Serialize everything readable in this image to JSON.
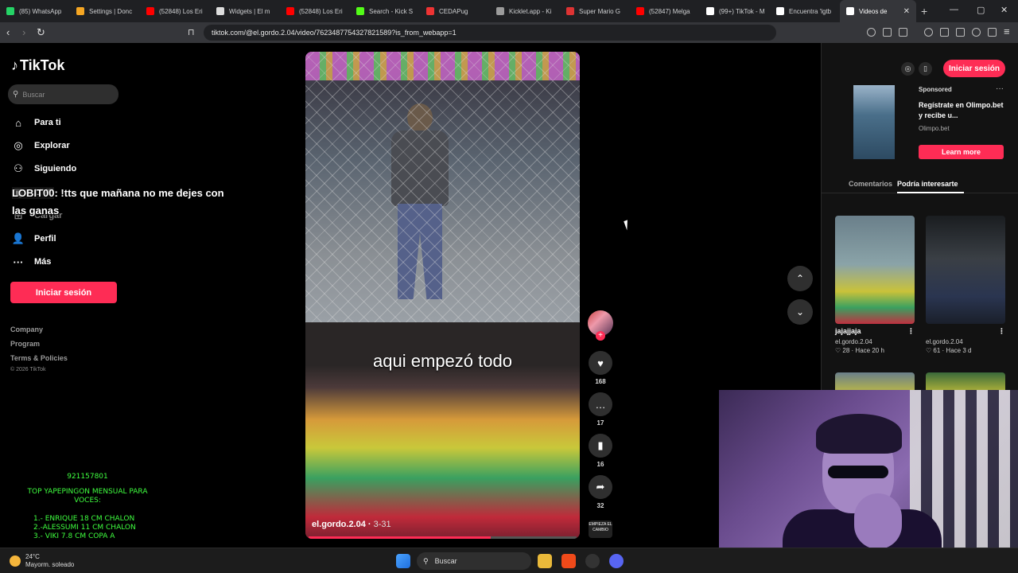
{
  "browser": {
    "tabs": [
      {
        "label": "(85) WhatsApp",
        "color": "#25d366"
      },
      {
        "label": "Settings | Donc",
        "color": "#f5a623"
      },
      {
        "label": "(52848) Los Eri",
        "color": "#ff0000"
      },
      {
        "label": "Widgets | El m",
        "color": "#dddddd"
      },
      {
        "label": "(52848) Los Eri",
        "color": "#ff0000"
      },
      {
        "label": "Search - Kick S",
        "color": "#53fc18"
      },
      {
        "label": "CEDAPug",
        "color": "#e33"
      },
      {
        "label": "Kicklet.app - Ki",
        "color": "#9b9b9b"
      },
      {
        "label": "Super Mario G",
        "color": "#d33"
      },
      {
        "label": "(52847) Melga",
        "color": "#ff0000"
      },
      {
        "label": "(99+) TikTok - M",
        "color": "#ffffff"
      },
      {
        "label": "Encuentra 'lgtb",
        "color": "#ffffff"
      },
      {
        "label": "Videos de",
        "color": "#ffffff",
        "active": true
      }
    ],
    "url": "tiktok.com/@el.gordo.2.04/video/7623487754327821589?is_from_webapp=1"
  },
  "sidebar": {
    "logo": "TikTok",
    "search_placeholder": "Buscar",
    "nav": [
      {
        "label": "Para ti",
        "icon": "home-icon"
      },
      {
        "label": "Explorar",
        "icon": "compass-icon"
      },
      {
        "label": "Siguiendo",
        "icon": "following-icon"
      },
      {
        "label": "LIVE",
        "icon": "live-icon"
      },
      {
        "label": "Cargar",
        "icon": "upload-icon"
      },
      {
        "label": "Perfil",
        "icon": "profile-icon"
      },
      {
        "label": "Más",
        "icon": "more-icon"
      }
    ],
    "login": "Iniciar sesión",
    "footer": [
      "Company",
      "Program",
      "Terms & Policies"
    ],
    "copyright": "© 2026 TikTok"
  },
  "overlay": {
    "chat_user": "LOBIT00",
    "chat_message": ": !tts que mañana no me dejes con las ganas",
    "donations": {
      "number": "921157801",
      "title": "TOP YAPEPINGON MENSUAL PARA VOCES:",
      "list": [
        "1.- ENRIQUE 18 CM CHALON",
        "2.-ALESSUMI 11 CM CHALON",
        "3.- VIKI 7.8 CM COPA A"
      ]
    }
  },
  "video": {
    "caption": "aqui empezó todo",
    "author": "el.gordo.2.04",
    "date": "3-31",
    "progress": 0.68,
    "actions": {
      "likes": "168",
      "comments": "17",
      "saves": "16",
      "shares": "32"
    },
    "music_label": "EMPIEZA EL CAMBIO"
  },
  "right_panel": {
    "login": "Iniciar sesión",
    "ad": {
      "sponsored": "Sponsored",
      "text": "Regístrate en Olimpo.bet y recibe u...",
      "domain": "Olimpo.bet",
      "cta": "Learn more"
    },
    "tabs": [
      "Comentarios",
      "Podría interesarte"
    ],
    "cards": [
      {
        "title": "jajajjaja",
        "author": "el.gordo.2.04",
        "likes": "28",
        "time": "Hace 20 h"
      },
      {
        "title": "",
        "author": "el.gordo.2.04",
        "likes": "61",
        "time": "Hace 3 d"
      }
    ]
  },
  "taskbar": {
    "weather_temp": "24°C",
    "weather_desc": "Mayorm. soleado",
    "search": "Buscar"
  }
}
